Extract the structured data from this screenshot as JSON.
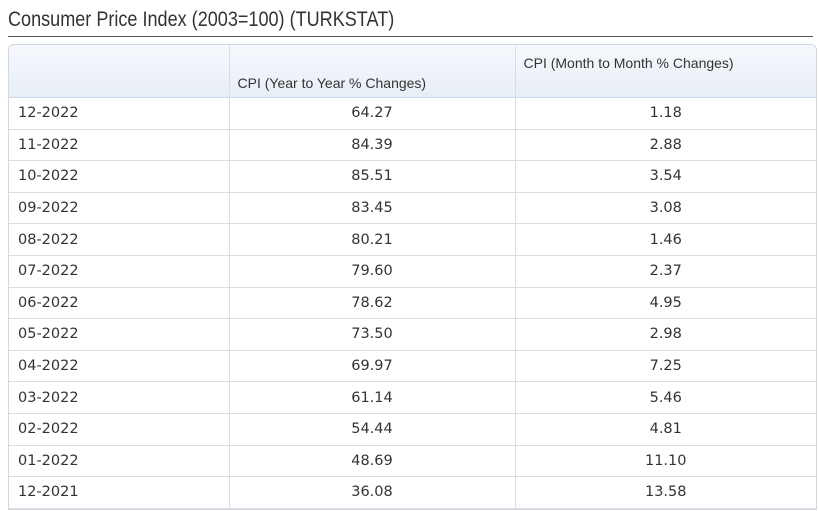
{
  "page": {
    "title": "Consumer Price Index (2003=100) (TURKSTAT)"
  },
  "table": {
    "columns": [
      "",
      "CPI (Year to Year % Changes)",
      "CPI (Month to Month  % Changes)"
    ],
    "rows": [
      {
        "date": "12-2022",
        "yoy": "64.27",
        "mom": "1.18"
      },
      {
        "date": "11-2022",
        "yoy": "84.39",
        "mom": "2.88"
      },
      {
        "date": "10-2022",
        "yoy": "85.51",
        "mom": "3.54"
      },
      {
        "date": "09-2022",
        "yoy": "83.45",
        "mom": "3.08"
      },
      {
        "date": "08-2022",
        "yoy": "80.21",
        "mom": "1.46"
      },
      {
        "date": "07-2022",
        "yoy": "79.60",
        "mom": "2.37"
      },
      {
        "date": "06-2022",
        "yoy": "78.62",
        "mom": "4.95"
      },
      {
        "date": "05-2022",
        "yoy": "73.50",
        "mom": "2.98"
      },
      {
        "date": "04-2022",
        "yoy": "69.97",
        "mom": "7.25"
      },
      {
        "date": "03-2022",
        "yoy": "61.14",
        "mom": "5.46"
      },
      {
        "date": "02-2022",
        "yoy": "54.44",
        "mom": "4.81"
      },
      {
        "date": "01-2022",
        "yoy": "48.69",
        "mom": "11.10"
      },
      {
        "date": "12-2021",
        "yoy": "36.08",
        "mom": "13.58"
      }
    ]
  },
  "colors": {
    "header_bg": "#e8eef7",
    "border": "#dddddd",
    "text": "#333333"
  }
}
